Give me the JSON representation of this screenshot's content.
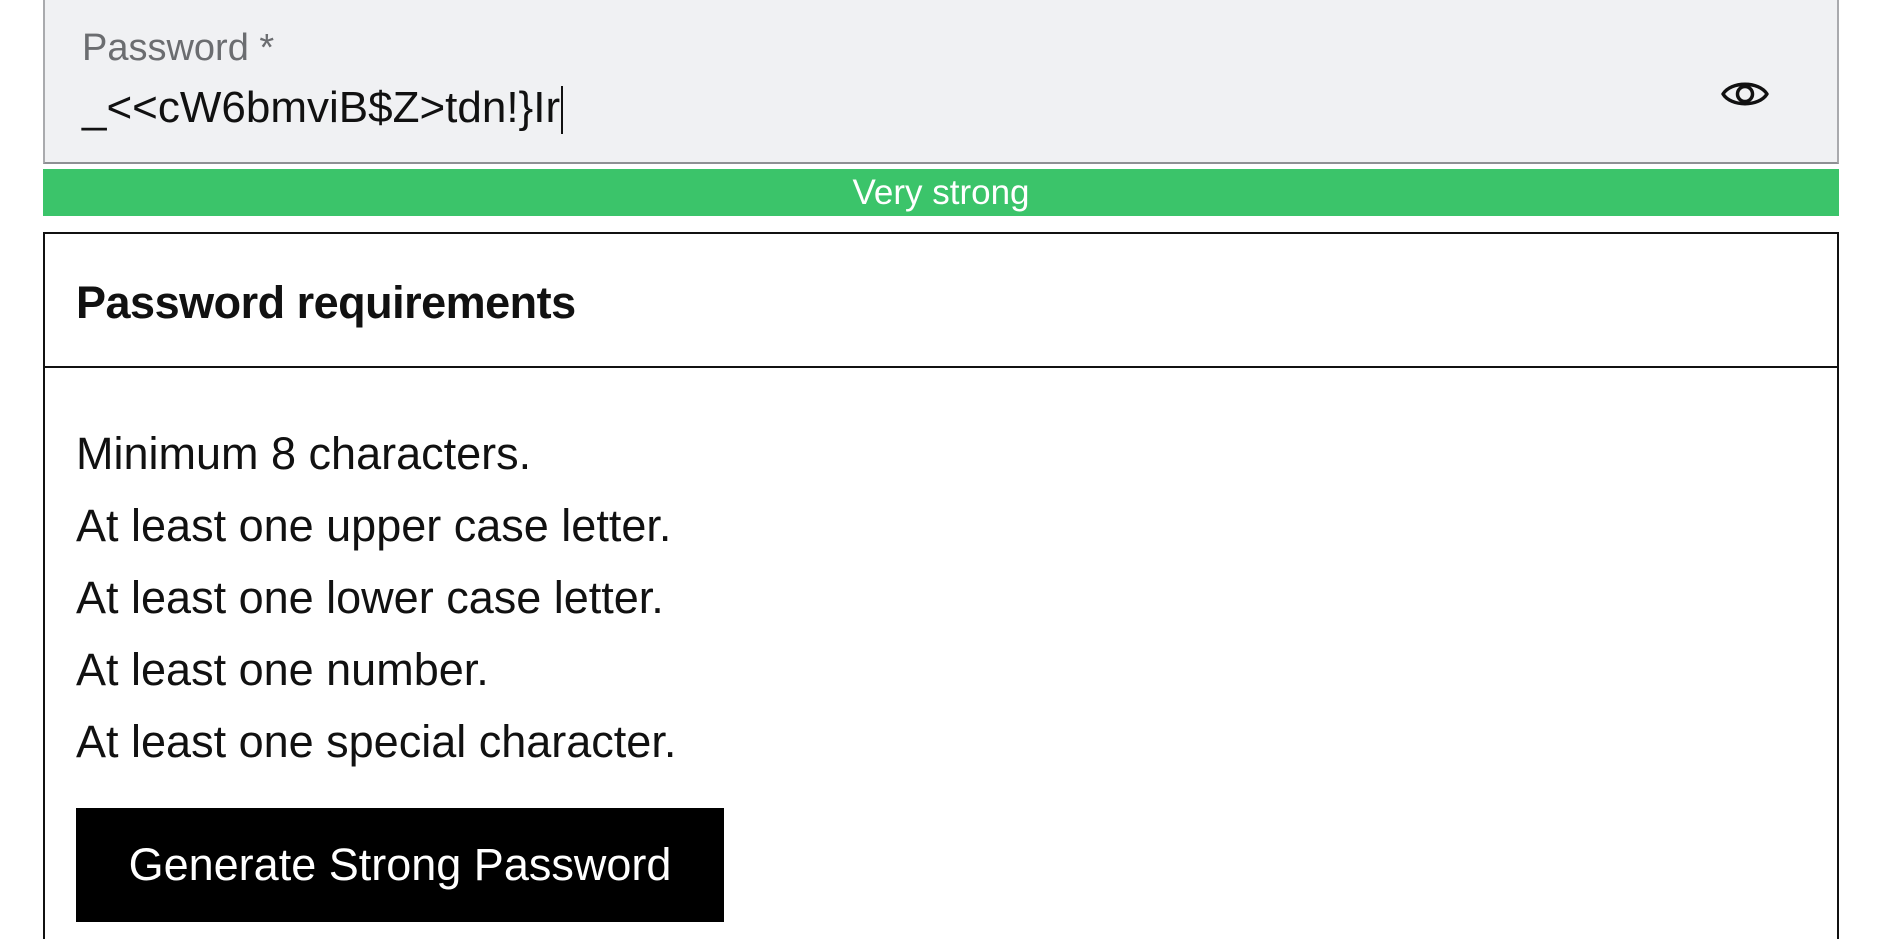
{
  "password_field": {
    "label": "Password *",
    "value": "_<<cW6bmviB$Z>tdn!}Ir",
    "toggle_icon": "eye-icon"
  },
  "strength": {
    "label": "Very strong",
    "color": "#3bc46a"
  },
  "requirements": {
    "title": "Password requirements",
    "items": [
      "Minimum 8 characters.",
      "At least one upper case letter.",
      "At least one lower case letter.",
      "At least one number.",
      "At least one special character."
    ],
    "generate_button": "Generate Strong Password"
  }
}
